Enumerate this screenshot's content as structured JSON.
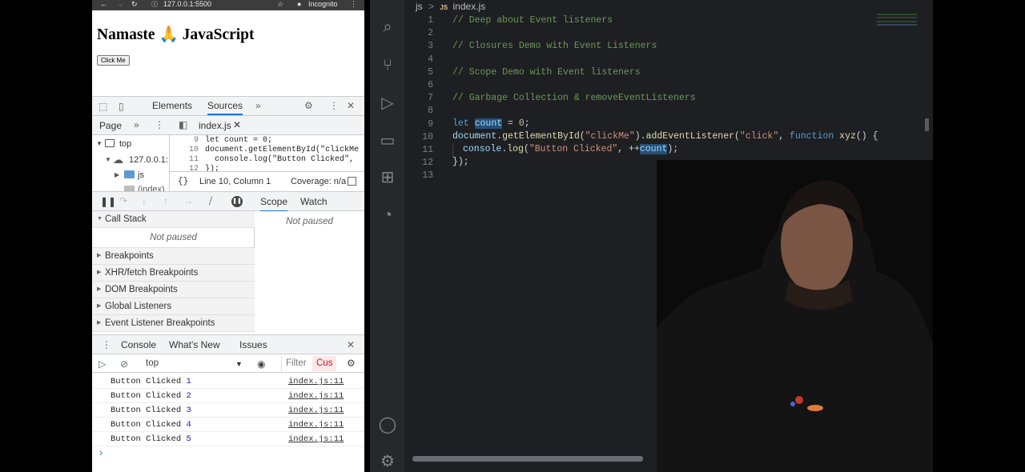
{
  "browser": {
    "url": "127.0.0.1:5500",
    "incognito_label": "Incognito",
    "page_heading": "Namaste 🙏 JavaScript",
    "button_label": "Click Me"
  },
  "devtools": {
    "tabs": [
      "Elements",
      "Sources"
    ],
    "nav": {
      "page_label": "Page",
      "file_tab": "index.js"
    },
    "tree": [
      "top",
      "127.0.0.1:",
      "js",
      "(index)"
    ],
    "mini_code": [
      {
        "ln": "9",
        "text": "let count = 0;"
      },
      {
        "ln": "10",
        "text": "document.getElementById(\"clickMe"
      },
      {
        "ln": "11",
        "text": "  console.log(\"Button Clicked\","
      },
      {
        "ln": "12",
        "text": "});"
      }
    ],
    "status": {
      "braces": "{}",
      "position": "Line 10, Column 1",
      "coverage": "Coverage: n/a"
    },
    "scope_tabs": [
      "Scope",
      "Watch"
    ],
    "not_paused": "Not paused",
    "call_stack": "Call Stack",
    "sections": [
      "Breakpoints",
      "XHR/fetch Breakpoints",
      "DOM Breakpoints",
      "Global Listeners",
      "Event Listener Breakpoints"
    ],
    "console_tabs": [
      "Console",
      "What's New",
      "Issues"
    ],
    "context": "top",
    "filter_placeholder": "Filter",
    "custom_levels": "Cus",
    "console_rows": [
      {
        "text": "Button Clicked ",
        "num": "1",
        "src": "index.js:11"
      },
      {
        "text": "Button Clicked ",
        "num": "2",
        "src": "index.js:11"
      },
      {
        "text": "Button Clicked ",
        "num": "3",
        "src": "index.js:11"
      },
      {
        "text": "Button Clicked ",
        "num": "4",
        "src": "index.js:11"
      },
      {
        "text": "Button Clicked ",
        "num": "5",
        "src": "index.js:11"
      }
    ],
    "prompt": "›"
  },
  "vscode": {
    "breadcrumb": {
      "folder": "js",
      "sep": ">",
      "js_badge": "JS",
      "file": "index.js"
    },
    "line_numbers": [
      "1",
      "2",
      "3",
      "4",
      "5",
      "6",
      "7",
      "8",
      "9",
      "10",
      "11",
      "12",
      "13"
    ],
    "code": {
      "l1": "// Deep about Event listeners",
      "l3": "// Closures Demo with Event Listeners",
      "l5": "// Scope Demo with Event listeners",
      "l7": "// Garbage Collection & removeEventListeners",
      "l9": {
        "kw": "let",
        "var": "count",
        "op": " = ",
        "num": "0",
        "end": ";"
      },
      "l10": {
        "obj": "document",
        "m1": "getElementById",
        "a1": "\"clickMe\"",
        "m2": "addEventListener",
        "a2": "\"click\"",
        "kw": "function",
        "fname": "xyz",
        "end": "() {"
      },
      "l11": {
        "obj": "console",
        "m": "log",
        "s": "\"Button Clicked\"",
        "op": ", ++",
        "var": "count",
        "end": ");"
      },
      "l12": "});"
    }
  },
  "colors": {
    "accent": "#1a73e8",
    "vscode_bg": "#1e1f22",
    "comment": "#6a9955"
  }
}
